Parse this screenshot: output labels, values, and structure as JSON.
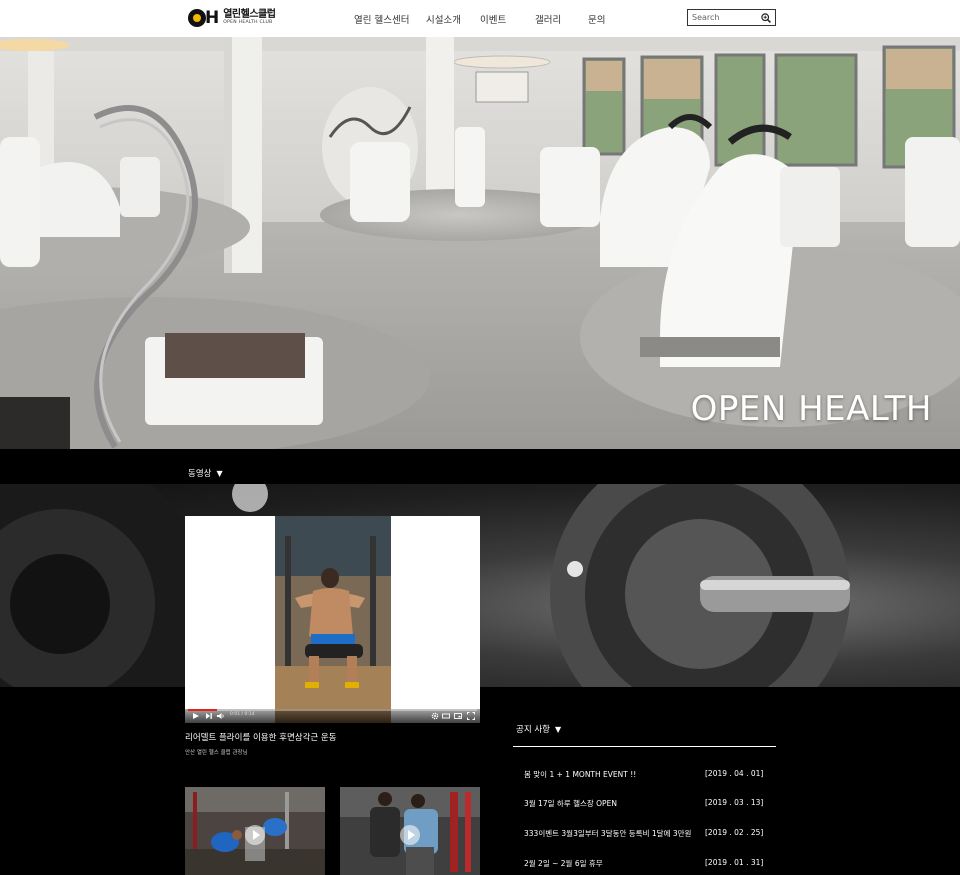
{
  "header": {
    "logo_kr": "열린헬스클럽",
    "logo_en": "OPEN HEALTH CLUB",
    "logo_mark": "OH",
    "nav": [
      {
        "label": "열린 헬스센터"
      },
      {
        "label": "시설소개"
      },
      {
        "label": "이벤트"
      },
      {
        "label": "갤러리"
      },
      {
        "label": "문의"
      }
    ],
    "search": {
      "placeholder": "Search",
      "icon": "search-icon"
    }
  },
  "hero": {
    "title": "OPEN HEALTH"
  },
  "video_section": {
    "title": "동영상",
    "caret": "▼",
    "player": {
      "time": "0:01 / 0:14",
      "progress": 0.1
    },
    "video_title": "리어델트 플라이를 이용한 후면삼각근 운동",
    "video_sub": "안산 열린 헬스 클럽 관장님"
  },
  "notice_section": {
    "title": "공지 사항",
    "caret": "▼",
    "items": [
      {
        "text": "봄 맞이 1 + 1 MONTH EVENT !!",
        "date": "[2019 . 04 . 01]"
      },
      {
        "text": "3월 17일 하루 헬스장 OPEN",
        "date": "[2019 . 03 . 13]"
      },
      {
        "text": "333이벤트 3월3일부터 3달동안 등록비  1달에 3만원",
        "date": "[2019 . 02 . 25]"
      },
      {
        "text": "2월 2일 ~ 2월 6일 휴무",
        "date": "[2019 . 01 . 31]"
      }
    ]
  },
  "colors": {
    "background": "#000000",
    "header_bg": "#ffffff",
    "progress": "#e62117",
    "logo_accent": "#f2b800"
  }
}
